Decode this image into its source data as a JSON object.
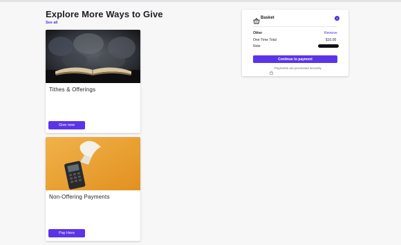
{
  "page": {
    "heading": "Explore More Ways to Give",
    "see_all": "See all"
  },
  "cards": [
    {
      "title": "Tithes & Offerings",
      "button": "Give now",
      "image": "open-bible-photo"
    },
    {
      "title": "Non-Offering Payments",
      "button": "Pay Here",
      "image": "card-terminal-receipt-photo"
    }
  ],
  "basket": {
    "title": "Basket",
    "count": "1",
    "item_name": "Other",
    "remove_label": "Remove",
    "total_label": "One-Time Total",
    "total_value": "$10.00",
    "note_label": "Note",
    "pay_button": "Continue to payment",
    "secure_text": "Payments are processed securely"
  },
  "colors": {
    "accent": "#5b34ea",
    "link": "#4b2ee6",
    "background": "#f7f7f8"
  }
}
